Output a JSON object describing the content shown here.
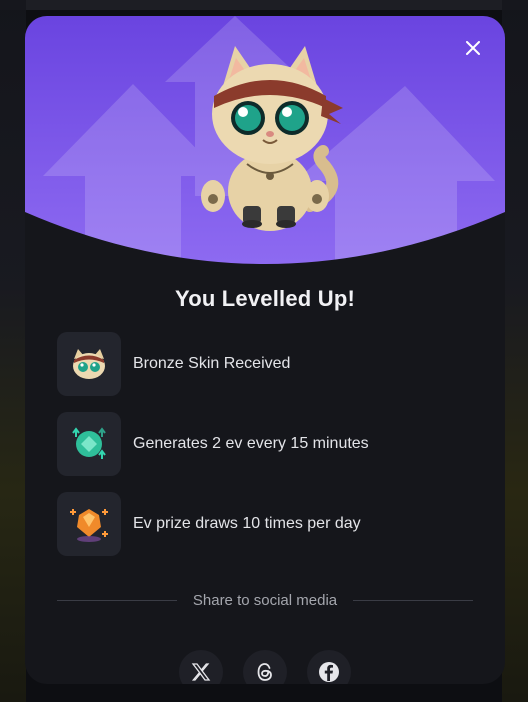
{
  "modal": {
    "title": "You Levelled Up!",
    "close_icon": "close-icon",
    "hero_icon": "cat-mascot-illustration"
  },
  "perks": [
    {
      "icon": "bronze-skin-cat-icon",
      "text": "Bronze Skin Received"
    },
    {
      "icon": "green-gem-shield-icon",
      "text": "Generates 2 ev every 15 minutes"
    },
    {
      "icon": "prize-gem-icon",
      "text": "Ev prize draws 10 times per day"
    }
  ],
  "share": {
    "label": "Share to social media",
    "buttons": [
      {
        "icon": "x-twitter-icon"
      },
      {
        "icon": "threads-icon"
      },
      {
        "icon": "facebook-icon"
      }
    ]
  },
  "colors": {
    "accent_purple": "#7a55e6",
    "modal_bg": "#15161b",
    "tile_bg": "#23252d"
  }
}
